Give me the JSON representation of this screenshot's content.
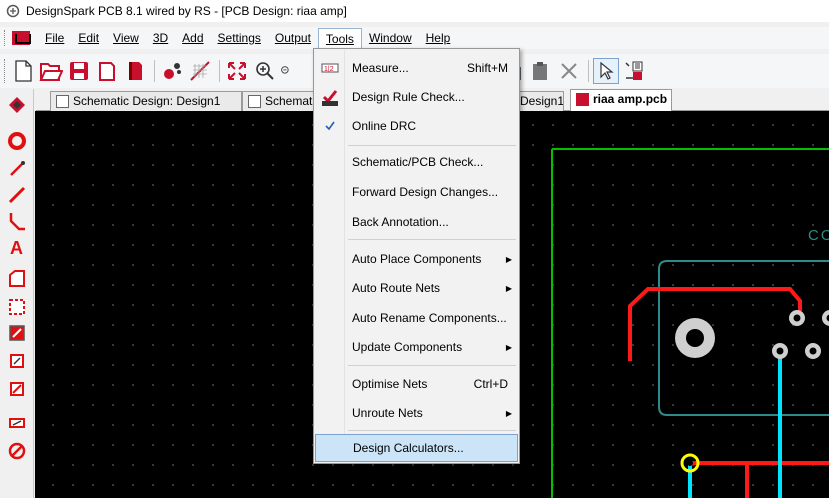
{
  "window": {
    "title": "DesignSpark PCB 8.1 wired by RS - [PCB Design: riaa amp]"
  },
  "menubar": {
    "items": [
      {
        "key": "file",
        "label": "File"
      },
      {
        "key": "edit",
        "label": "Edit"
      },
      {
        "key": "view",
        "label": "View"
      },
      {
        "key": "3d",
        "label": "3D"
      },
      {
        "key": "add",
        "label": "Add"
      },
      {
        "key": "settings",
        "label": "Settings"
      },
      {
        "key": "output",
        "label": "Output"
      },
      {
        "key": "tools",
        "label": "Tools"
      },
      {
        "key": "window",
        "label": "Window"
      },
      {
        "key": "help",
        "label": "Help"
      }
    ]
  },
  "tabs": [
    {
      "label": "Schematic Design: Design1",
      "active": false
    },
    {
      "label": "Schemat",
      "active": false
    },
    {
      "label": "Design1",
      "active": false
    },
    {
      "label": "riaa amp.pcb",
      "active": true
    }
  ],
  "tools_menu": {
    "items": [
      {
        "label": "Measure...",
        "shortcut": "Shift+M",
        "icon": "measure-icon"
      },
      {
        "label": "Design Rule Check...",
        "shortcut": "",
        "icon": "drc-icon"
      },
      {
        "label": "Online DRC",
        "shortcut": "",
        "icon": "check-icon",
        "checked": true
      },
      {
        "label": "Schematic/PCB Check...",
        "shortcut": ""
      },
      {
        "label": "Forward Design Changes...",
        "shortcut": ""
      },
      {
        "label": "Back Annotation...",
        "shortcut": ""
      },
      {
        "label": "Auto Place Components",
        "submenu": true
      },
      {
        "label": "Auto Route Nets",
        "submenu": true
      },
      {
        "label": "Auto Rename Components...",
        "shortcut": ""
      },
      {
        "label": "Update Components",
        "submenu": true
      },
      {
        "label": "Optimise Nets",
        "shortcut": "Ctrl+D"
      },
      {
        "label": "Unroute Nets",
        "submenu": true
      },
      {
        "label": "Design Calculators...",
        "shortcut": "",
        "highlighted": true
      }
    ]
  },
  "canvas": {
    "silkscreen_text": "CO"
  },
  "colors": {
    "board_outline": "#00c000",
    "track_red": "#ff1a1a",
    "track_cyan": "#00e5ff",
    "component_outline": "#2e8b8b",
    "pad_fill": "#cfcfcf",
    "via_yellow": "#ffff00"
  }
}
